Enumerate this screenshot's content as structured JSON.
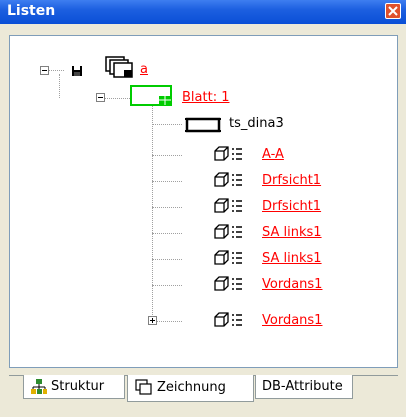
{
  "window": {
    "title": "Listen"
  },
  "tree": {
    "root_label": "a",
    "sheet_label": "Blatt: 1",
    "frame_label": "ts_dina3",
    "items": [
      {
        "label": "A-A"
      },
      {
        "label": "Drfsicht1"
      },
      {
        "label": "Drfsicht1"
      },
      {
        "label": "SA links1"
      },
      {
        "label": "SA links1"
      },
      {
        "label": "Vordans1"
      },
      {
        "label": "Vordans1"
      }
    ]
  },
  "tabs": [
    {
      "label": "Struktur",
      "icon": "structure-icon"
    },
    {
      "label": "Zeichnung",
      "icon": "drawing-icon",
      "active": true
    },
    {
      "label": "DB-Attribute"
    }
  ],
  "colors": {
    "link_red": "#ff0000",
    "sheet_green": "#00cc00",
    "title_blue": "#0a4fd6"
  }
}
